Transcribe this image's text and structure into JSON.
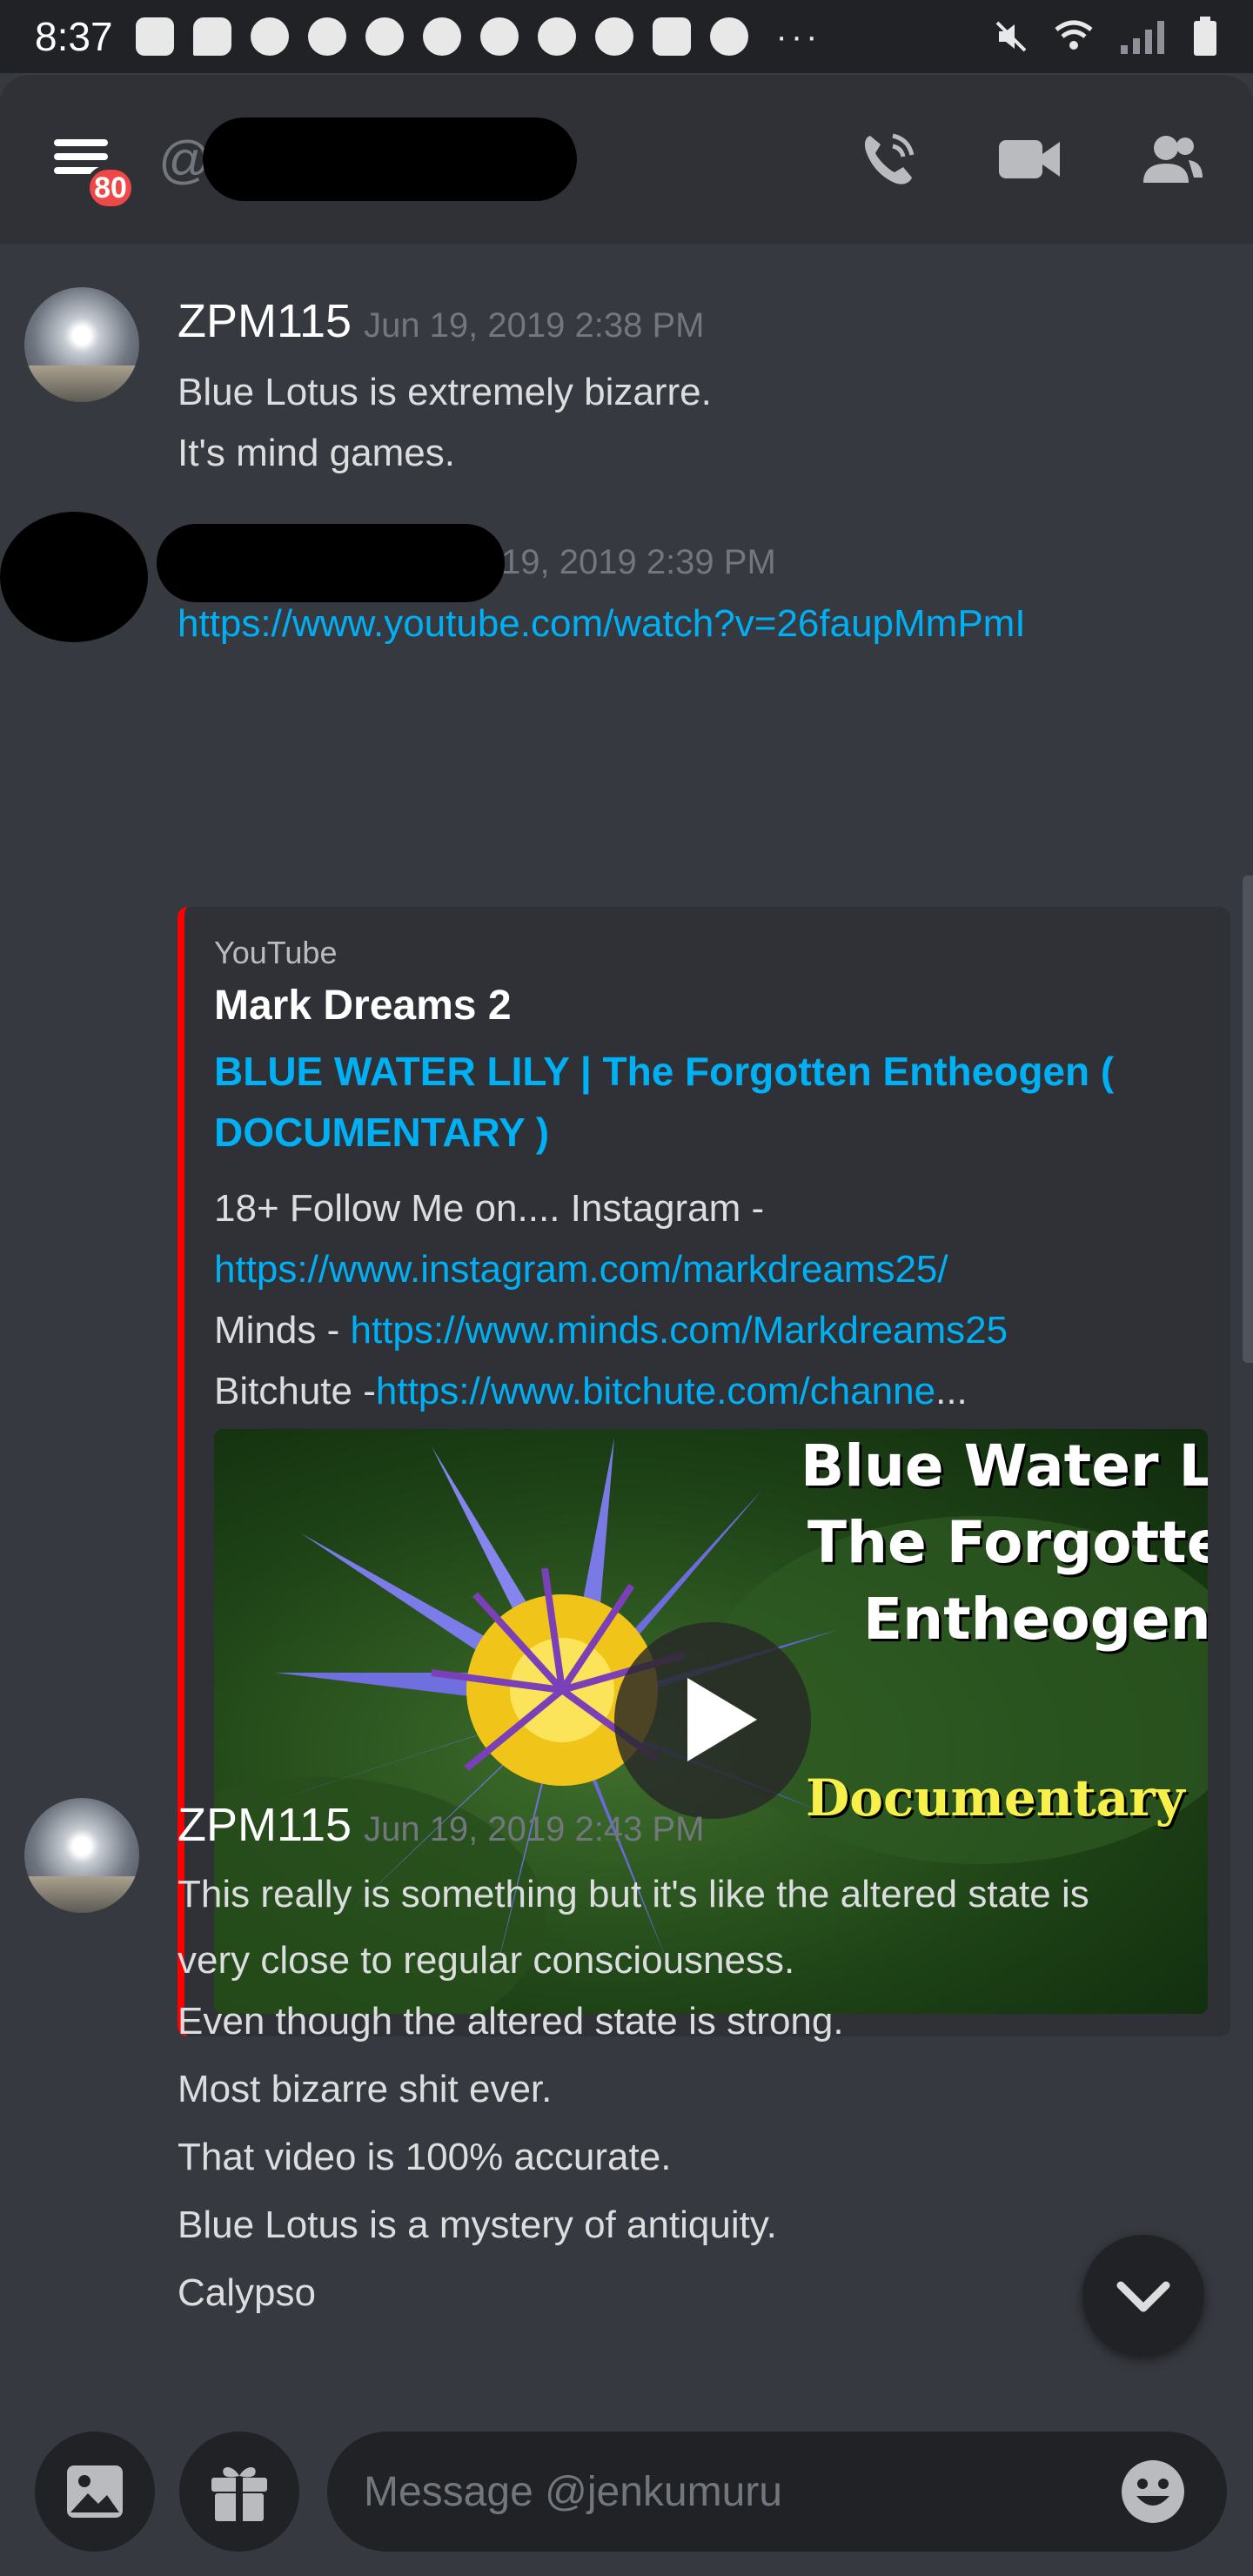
{
  "status_bar": {
    "time": "8:37",
    "notification_icons": [
      "bag-icon",
      "chat-bubble-icon",
      "discord-icon",
      "discord-icon",
      "discord-icon",
      "discord-icon",
      "discord-icon",
      "discord-icon",
      "snapchat-icon",
      "youtube-icon",
      "reddit-icon"
    ],
    "overflow": "···",
    "system_icons": [
      "mute-icon",
      "wifi-icon",
      "signal-icon",
      "battery-icon"
    ]
  },
  "header": {
    "unread_badge": "80",
    "at_symbol": "@"
  },
  "messages": [
    {
      "author": "ZPM115",
      "timestamp": "Jun 19, 2019 2:38 PM",
      "lines": [
        "Blue Lotus is extremely bizarre.",
        "It's mind games."
      ]
    },
    {
      "timestamp_visible": "19, 2019 2:39 PM",
      "link": "https://www.youtube.com/watch?v=26faupMmPmI",
      "embed": {
        "provider": "YouTube",
        "author": "Mark Dreams 2",
        "title": "BLUE WATER LILY | The Forgotten Entheogen ( DOCUMENTARY )",
        "desc_line1": "18+ Follow Me on.... Instagram -",
        "desc_link1": "https://www.instagram.com/markdreams25/",
        "desc_minds_label": "Minds - ",
        "desc_link2": "https://www.minds.com/Markdreams25",
        "desc_bitchute_label": "Bitchute -",
        "desc_link3": "https://www.bitchute.com/channe",
        "desc_ellipsis": "...",
        "thumbnail_text": {
          "line1": "Blue Water Lily",
          "line2": "The Forgotten",
          "line3": "Entheogen",
          "line4": "Documentary"
        }
      }
    },
    {
      "author": "ZPM115",
      "timestamp": "Jun 19, 2019 2:43 PM",
      "lines": [
        "This really is something but it's like the altered state is",
        "very close to regular consciousness.",
        "Even though the altered state is strong.",
        "Most bizarre shit ever.",
        "That video is 100% accurate.",
        "Blue Lotus is a mystery of antiquity.",
        "Calypso"
      ]
    }
  ],
  "composer": {
    "placeholder": "Message @jenkumuru"
  },
  "colors": {
    "background": "#36393f",
    "header": "#2f3136",
    "link": "#00b0f4",
    "badge": "#f04747",
    "embed_accent": "#ff0000"
  }
}
